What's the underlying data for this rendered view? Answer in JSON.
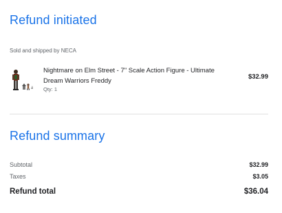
{
  "header": {
    "title": "Refund initiated"
  },
  "seller": {
    "text": "Sold and shipped by NECA"
  },
  "item": {
    "image_icon": "action-figure-image",
    "name": "Nightmare on Elm Street - 7\" Scale Action Figure - Ultimate Dream Warriors Freddy",
    "qty": "Qty: 1",
    "price": "$32.99"
  },
  "summary": {
    "title": "Refund summary",
    "subtotal_label": "Subtotal",
    "subtotal_value": "$32.99",
    "taxes_label": "Taxes",
    "taxes_value": "$3.05",
    "total_label": "Refund total",
    "total_value": "$36.04"
  },
  "colors": {
    "accent": "#1a73e8",
    "text": "#202124",
    "secondary_text": "#5f6368",
    "divider": "#e0e0e0"
  }
}
